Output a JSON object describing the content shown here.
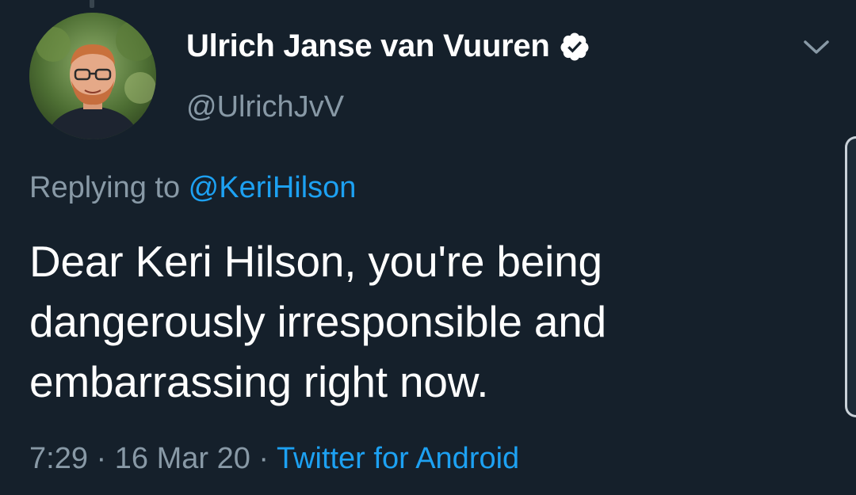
{
  "tweet": {
    "author": {
      "display_name": "Ulrich Janse van Vuuren",
      "handle": "@UlrichJvV",
      "verified": true
    },
    "reply": {
      "prefix": "Replying to ",
      "mention": "@KeriHilson"
    },
    "text_lines": [
      "Dear Keri Hilson, you're being",
      "dangerously irresponsible and",
      "embarrassing right now."
    ],
    "meta": {
      "time": "7:29",
      "separator": " · ",
      "date": "16 Mar 20",
      "source": "Twitter for Android"
    }
  },
  "colors": {
    "background": "#15202b",
    "primary_text": "#ffffff",
    "secondary_text": "#8899a6",
    "accent": "#1da1f2"
  },
  "icons": {
    "verified": "verified-badge-icon",
    "menu": "chevron-down-icon"
  }
}
